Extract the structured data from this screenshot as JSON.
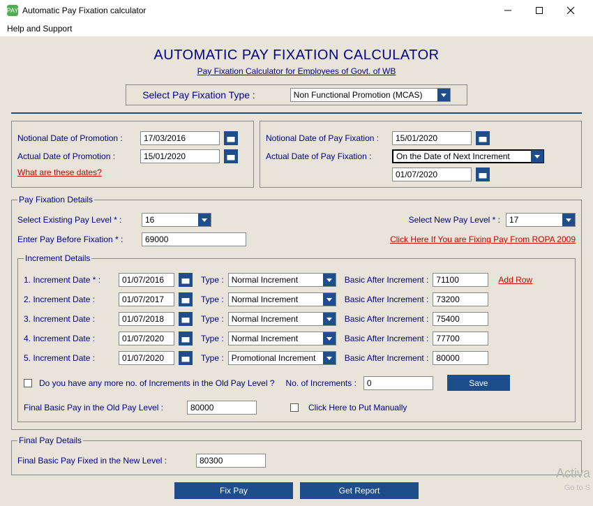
{
  "window": {
    "title": "Automatic Pay Fixation calculator"
  },
  "menu": {
    "help": "Help and Support"
  },
  "header": {
    "main_title": "AUTOMATIC PAY FIXATION CALCULATOR",
    "subtitle": "Pay Fixation Calculator for Employees of Govt. of WB",
    "select_type_label": "Select Pay Fixation Type :",
    "select_type_value": "Non Functional Promotion (MCAS)"
  },
  "dates": {
    "notional_promotion_label": "Notional Date of Promotion :",
    "notional_promotion_value": "17/03/2016",
    "actual_promotion_label": "Actual Date of Promotion :",
    "actual_promotion_value": "15/01/2020",
    "what_are_these": "What are these dates?",
    "notional_fixation_label": "Notional Date of Pay Fixation :",
    "notional_fixation_value": "15/01/2020",
    "actual_fixation_label": "Actual Date of Pay Fixation :",
    "actual_fixation_value": "On the Date of Next Increment",
    "actual_fixation_date": "01/07/2020"
  },
  "pay_details": {
    "legend": "Pay Fixation Details",
    "existing_level_label": "Select Existing Pay Level * :",
    "existing_level_value": "16",
    "new_level_label": "Select New Pay Level * :",
    "new_level_value": "17",
    "pay_before_label": "Enter Pay Before Fixation * :",
    "pay_before_value": "69000",
    "ropa_link": "Click Here If You are Fixing Pay From ROPA 2009"
  },
  "increment": {
    "legend": "Increment Details",
    "type_label": "Type :",
    "basic_after_label": "Basic After Increment :",
    "add_row": "Add Row",
    "rows": [
      {
        "label": "1. Increment Date * :",
        "date": "01/07/2016",
        "type": "Normal Increment",
        "basic": "71100"
      },
      {
        "label": "2. Increment Date :",
        "date": "01/07/2017",
        "type": "Normal Increment",
        "basic": "73200"
      },
      {
        "label": "3. Increment Date :",
        "date": "01/07/2018",
        "type": "Normal Increment",
        "basic": "75400"
      },
      {
        "label": "4. Increment Date :",
        "date": "01/07/2020",
        "type": "Normal Increment",
        "basic": "77700"
      },
      {
        "label": "5. Increment Date :",
        "date": "01/07/2020",
        "type": "Promotional Increment",
        "basic": "80000"
      }
    ],
    "more_inc_label": "Do you have any more no. of Increments in the Old Pay Level ?",
    "no_inc_label": "No. of Increments :",
    "no_inc_value": "0",
    "save_btn": "Save",
    "final_basic_old_label": "Final Basic Pay in the Old Pay Level :",
    "final_basic_old_value": "80000",
    "put_manually_label": "Click Here to Put Manually"
  },
  "final": {
    "legend": "Final Pay Details",
    "final_basic_new_label": "Final Basic Pay Fixed in the New Level :",
    "final_basic_new_value": "80300"
  },
  "buttons": {
    "fix_pay": "Fix Pay",
    "get_report": "Get Report"
  },
  "watermark": {
    "line1": "Activa",
    "line2": "Go to S"
  }
}
